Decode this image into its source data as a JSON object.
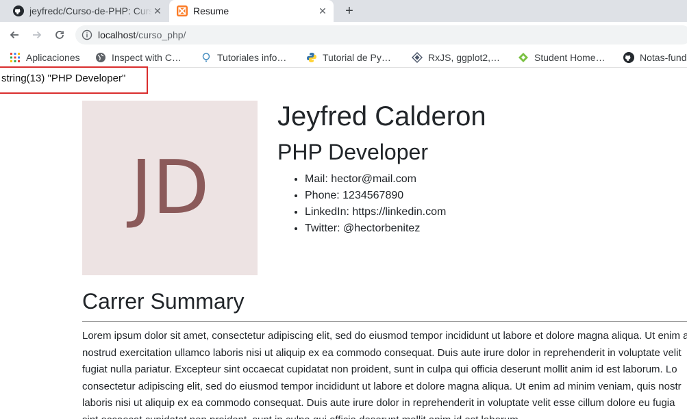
{
  "browser": {
    "tabs": [
      {
        "title": "jeyfredc/Curso-de-PHP: Curso de PHP",
        "icon": "github-icon",
        "active": false
      },
      {
        "title": "Resume",
        "icon": "xampp-icon",
        "active": true
      }
    ],
    "new_tab_label": "+",
    "url": {
      "host": "localhost",
      "path": "/curso_php/"
    },
    "bookmarks": [
      {
        "label": "Aplicaciones",
        "icon": "apps-grid-icon"
      },
      {
        "label": "Inspect with C…",
        "icon": "globe-icon"
      },
      {
        "label": "Tutoriales info…",
        "icon": "bulb-icon"
      },
      {
        "label": "Tutorial de Py…",
        "icon": "python-icon"
      },
      {
        "label": "RxJS, ggplot2,…",
        "icon": "diamond-icon"
      },
      {
        "label": "Student Home…",
        "icon": "green-diamond-icon"
      },
      {
        "label": "Notas-funda",
        "icon": "github-icon"
      }
    ]
  },
  "page": {
    "var_dump": "string(13) \"PHP Developer\"",
    "avatar_initials": "JD",
    "name": "Jeyfred Calderon",
    "role": "PHP Developer",
    "contacts": [
      "Mail: hector@mail.com",
      "Phone: 1234567890",
      "LinkedIn: https://linkedin.com",
      "Twitter: @hectorbenitez"
    ],
    "summary_title": "Carrer Summary",
    "summary_lines": [
      "Lorem ipsum dolor sit amet, consectetur adipiscing elit, sed do eiusmod tempor incididunt ut labore et dolore magna aliqua. Ut enim ad",
      "nostrud exercitation ullamco laboris nisi ut aliquip ex ea commodo consequat. Duis aute irure dolor in reprehenderit in voluptate velit",
      "fugiat nulla pariatur. Excepteur sint occaecat cupidatat non proident, sunt in culpa qui officia deserunt mollit anim id est laborum. Lo",
      "consectetur adipiscing elit, sed do eiusmod tempor incididunt ut labore et dolore magna aliqua. Ut enim ad minim veniam, quis nostr",
      "laboris nisi ut aliquip ex ea commodo consequat. Duis aute irure dolor in reprehenderit in voluptate velit esse cillum dolore eu fugia",
      "sint occaecat cupidatat non proident, sunt in culpa qui officia deserunt mollit anim id est laborum."
    ]
  },
  "colors": {
    "tab_strip": "#dee1e6",
    "avatar_bg": "#ede3e3",
    "avatar_text": "#8b5a5a",
    "dump_border": "#d92d2d",
    "xampp_orange": "#fb7a24"
  }
}
